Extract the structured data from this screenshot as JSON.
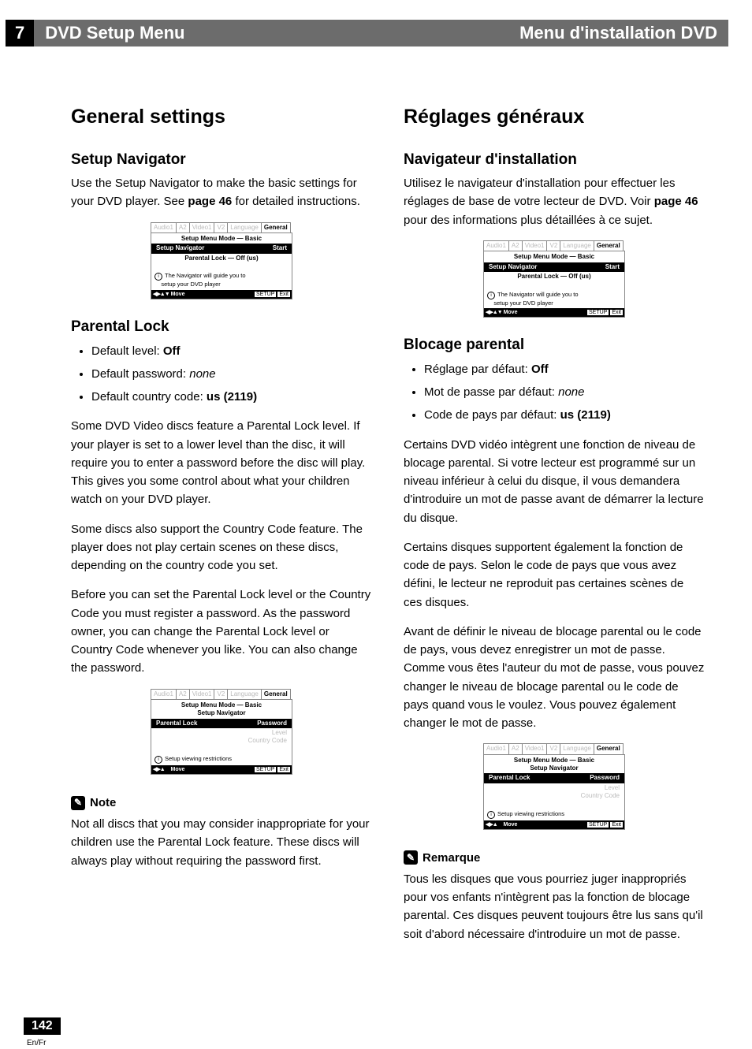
{
  "header": {
    "chapter": "7",
    "title_en": "DVD Setup Menu",
    "title_fr": "Menu d'installation DVD"
  },
  "left": {
    "h1": "General settings",
    "nav_h": "Setup Navigator",
    "nav_p": "Use the Setup Navigator to make the basic settings for your DVD player. See ",
    "nav_ref": "page 46",
    "nav_p2": " for detailed instructions.",
    "pl_h": "Parental Lock",
    "pl_b1a": "Default level: ",
    "pl_b1b": "Off",
    "pl_b2a": "Default password: ",
    "pl_b2b": "none",
    "pl_b3a": "Default country code: ",
    "pl_b3b": "us (2119)",
    "pl_p1": "Some DVD Video discs feature a Parental Lock level. If your player is set to a lower level than the disc, it will require you to enter a password before the disc will play. This gives you some control about what your children watch on your DVD player.",
    "pl_p2": "Some discs also support the Country Code feature. The player does not play certain scenes on these discs, depending on the country code you set.",
    "pl_p3": "Before you can set the Parental Lock level or the Country Code you must register a password. As the password owner, you can change the Parental Lock level or Country Code whenever you like. You can also change the password.",
    "note_h": "Note",
    "note_p": "Not all discs that you may consider inappropriate for your children use the Parental Lock feature. These discs will always play without requiring the password first."
  },
  "right": {
    "h1": "Réglages généraux",
    "nav_h": "Navigateur d'installation",
    "nav_p": "Utilisez le navigateur d'installation pour effectuer les réglages de base de votre lecteur de DVD. Voir ",
    "nav_ref": "page 46",
    "nav_p2": " pour des informations plus détaillées à ce sujet.",
    "pl_h": "Blocage parental",
    "pl_b1a": "Réglage par défaut: ",
    "pl_b1b": "Off",
    "pl_b2a": "Mot de passe par défaut: ",
    "pl_b2b": "none",
    "pl_b3a": "Code de pays par défaut: ",
    "pl_b3b": "us (2119)",
    "pl_p1": "Certains DVD vidéo intègrent une fonction de niveau de blocage parental. Si votre lecteur est programmé sur un niveau inférieur à celui du disque, il vous demandera d'introduire un mot de passe avant de démarrer la lecture du disque.",
    "pl_p2": "Certains disques supportent également la fonction de code de pays. Selon le code de pays que vous avez défini, le lecteur ne reproduit pas certaines scènes de ces disques.",
    "pl_p3": "Avant de définir le niveau de blocage parental ou le code de pays, vous devez enregistrer un mot de passe. Comme vous êtes l'auteur du mot de passe, vous pouvez changer le niveau de blocage parental ou le code de pays quand vous le voulez. Vous pouvez également changer le mot de passe.",
    "note_h": "Remarque",
    "note_p": "Tous les disques que vous pourriez juger inappropriés pour vos enfants n'intègrent pas la fonction de blocage parental. Ces disques peuvent toujours être lus sans qu'il soit d'abord nécessaire d'introduire un mot de passe."
  },
  "menu": {
    "tabs": [
      "Audio1",
      "A2",
      "Video1",
      "V2",
      "Language",
      "General"
    ],
    "mode": "Setup Menu Mode — Basic",
    "nav_label": "Setup Navigator",
    "start": "Start",
    "plock_off": "Parental Lock — Off (us)",
    "hint1a": "The Navigator will guide you to",
    "hint1b": "setup your DVD player",
    "hint2": "Setup viewing restrictions",
    "move": "Move",
    "setup_btn": "SETUP",
    "exit_btn": "Exit",
    "pl_label": "Parental Lock",
    "pw": "Password",
    "level": "Level",
    "cc": "Country Code"
  },
  "footer": {
    "page": "142",
    "lang": "En/Fr"
  }
}
